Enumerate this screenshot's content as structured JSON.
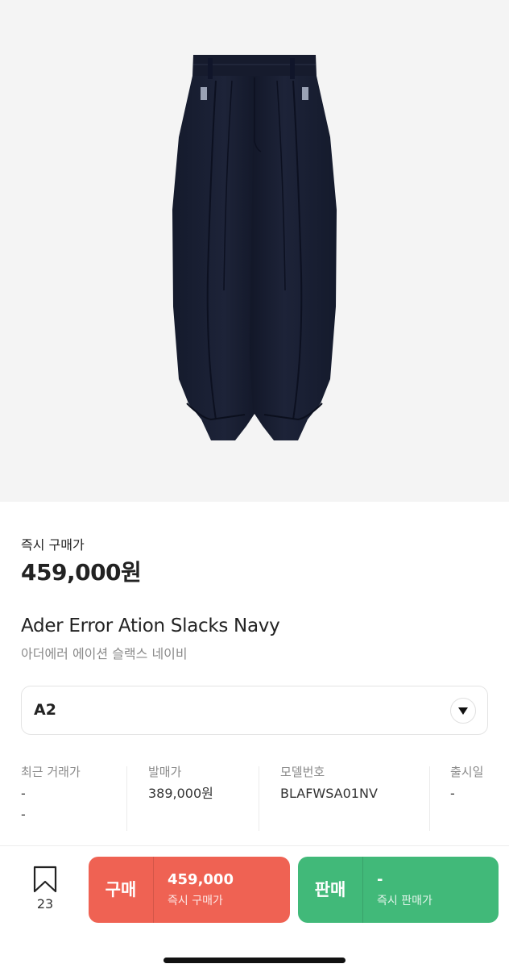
{
  "product": {
    "price_label": "즉시 구매가",
    "price": "459,000원",
    "name_en": "Ader Error Ation Slacks Navy",
    "name_ko": "아더에러 에이션 슬랙스 네이비"
  },
  "size_selector": {
    "value": "A2",
    "icon": "caret-down-icon"
  },
  "info": [
    {
      "label": "최근 거래가",
      "lines": [
        "-",
        "-"
      ]
    },
    {
      "label": "발매가",
      "lines": [
        "389,000원"
      ]
    },
    {
      "label": "모델번호",
      "lines": [
        "BLAFWSA01NV"
      ]
    },
    {
      "label": "출시일",
      "lines": [
        "-"
      ]
    }
  ],
  "bottom_bar": {
    "bookmark_count": "23",
    "buy": {
      "label": "구매",
      "price": "459,000",
      "sub": "즉시 구매가",
      "color": "#ef6253"
    },
    "sell": {
      "label": "판매",
      "price": "-",
      "sub": "즉시 판매가",
      "color": "#41b979"
    }
  }
}
